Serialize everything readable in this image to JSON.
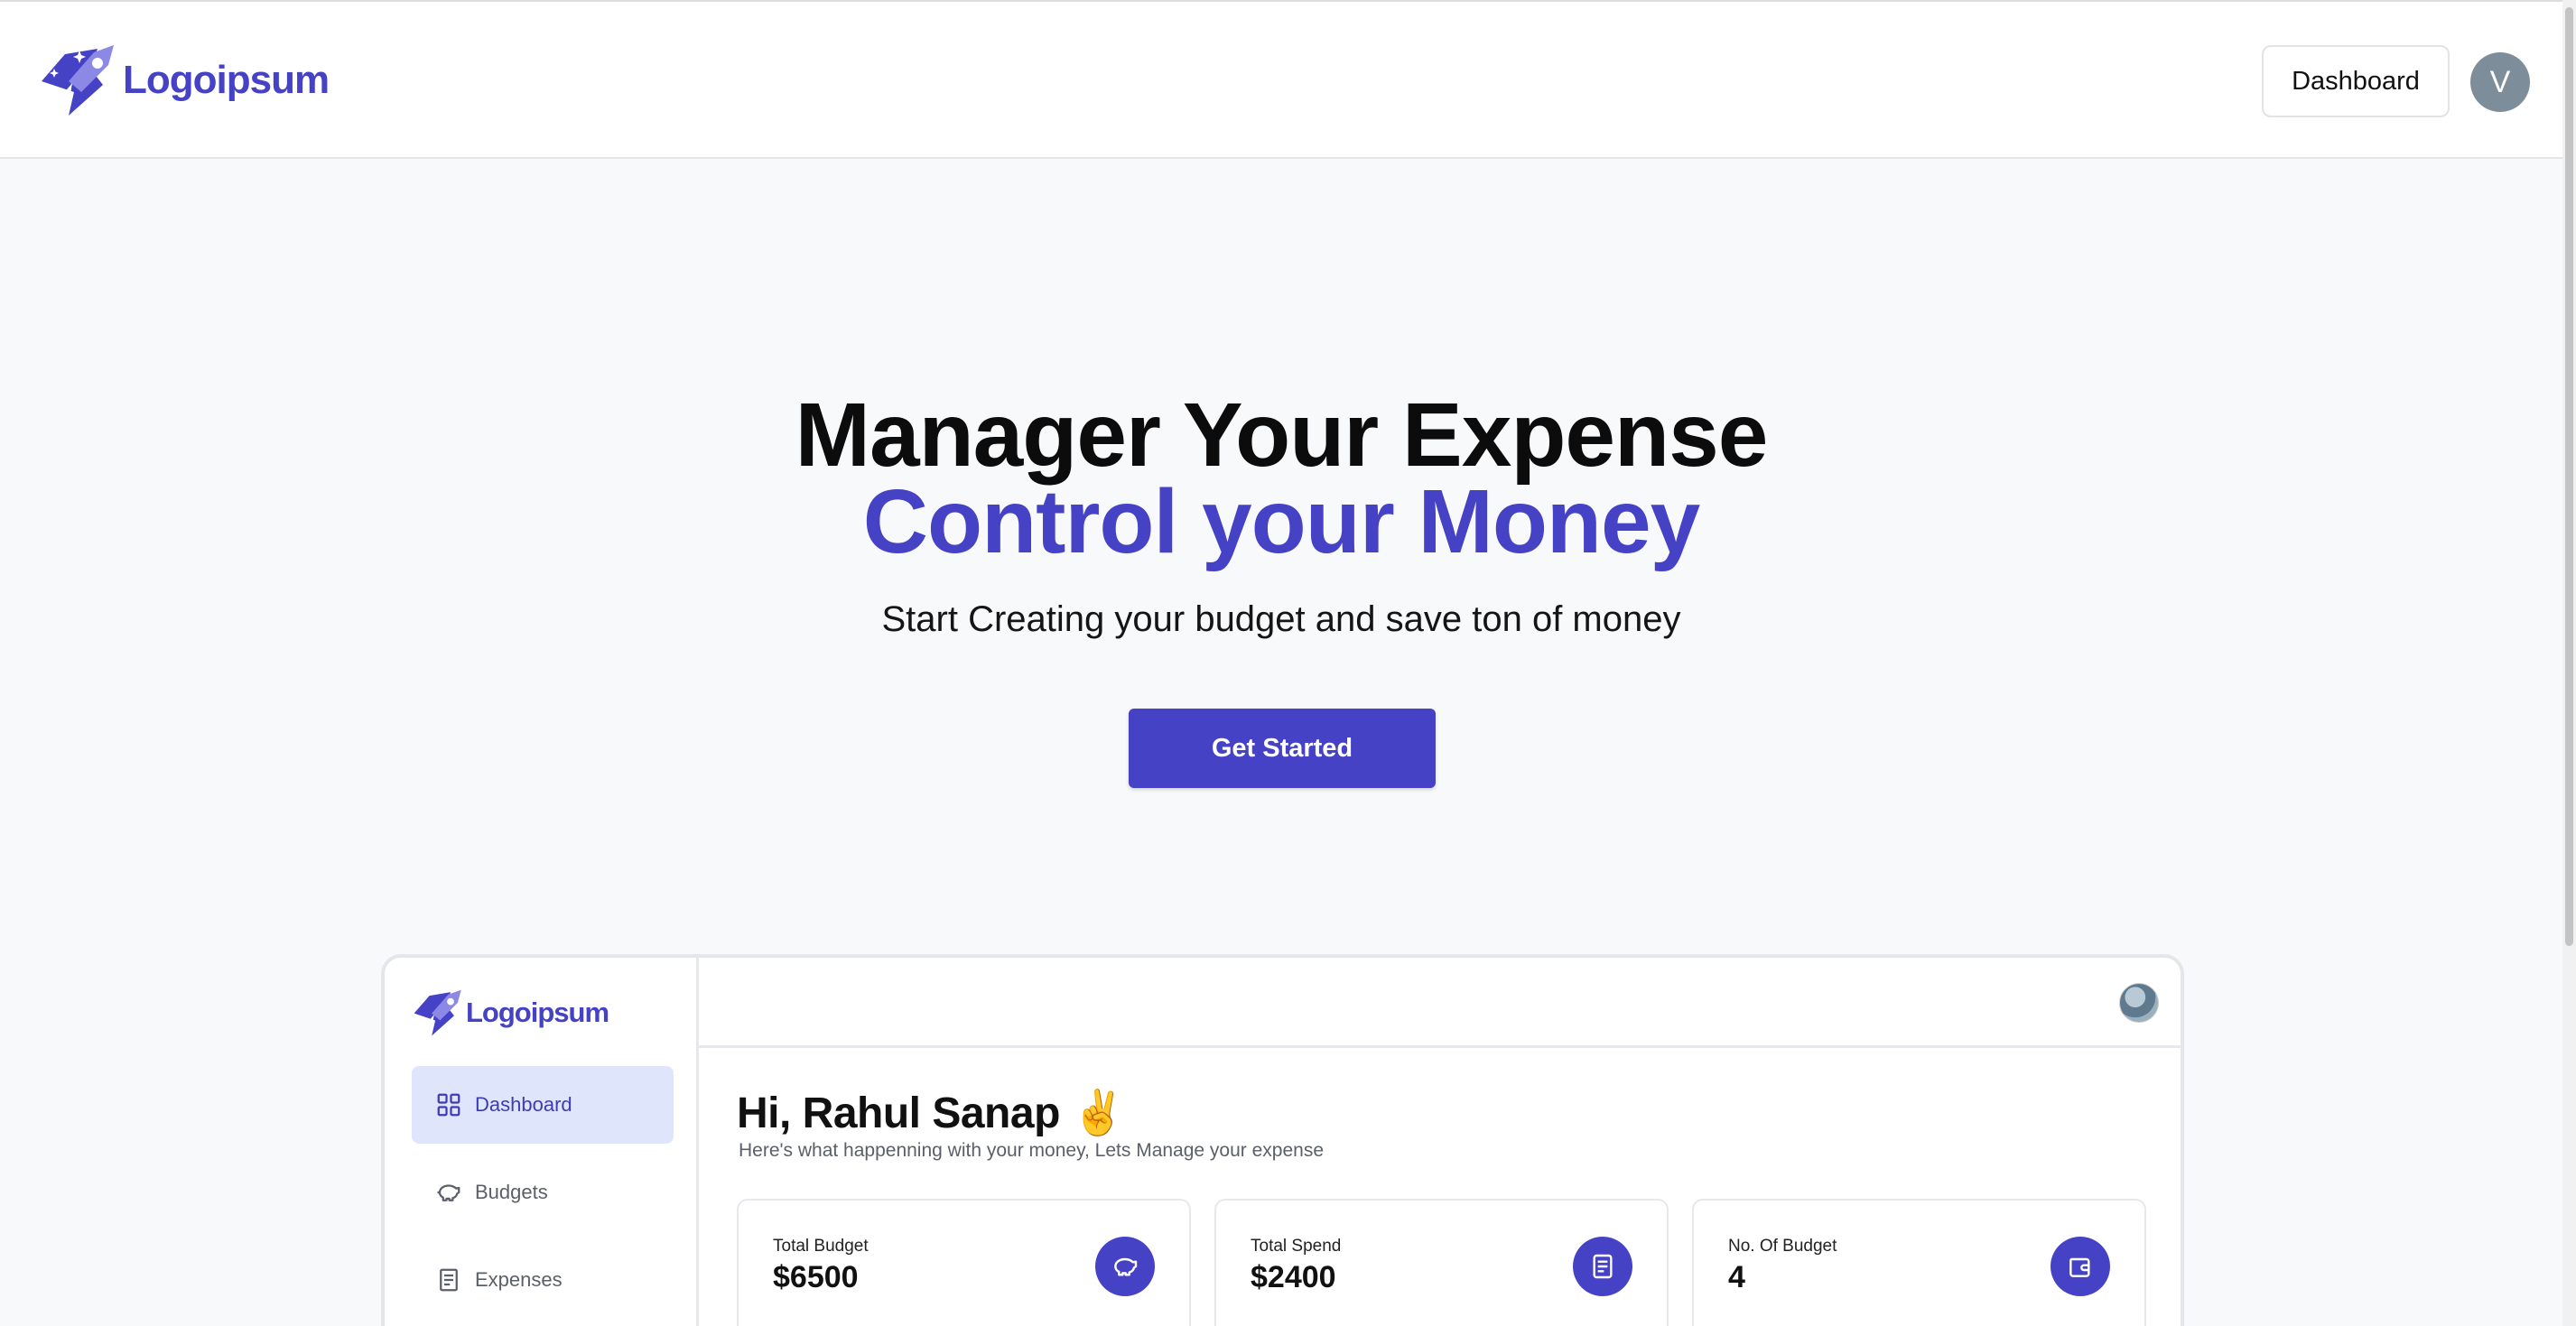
{
  "header": {
    "brand_name": "Logoipsum",
    "dashboard_label": "Dashboard",
    "avatar_initial": "V"
  },
  "hero": {
    "title_line1": "Manager Your Expense",
    "title_line2": "Control your Money",
    "subtitle": "Start Creating your budget and save ton of money",
    "cta_label": "Get Started"
  },
  "preview": {
    "brand_name": "Logoipsum",
    "sidebar": {
      "items": [
        {
          "label": "Dashboard",
          "icon": "grid-icon",
          "active": true
        },
        {
          "label": "Budgets",
          "icon": "piggy-bank-icon",
          "active": false
        },
        {
          "label": "Expenses",
          "icon": "receipt-icon",
          "active": false
        }
      ]
    },
    "greeting": "Hi, Rahul Sanap ✌️",
    "greeting_sub": "Here's what happenning with your money, Lets Manage your expense",
    "cards": [
      {
        "label": "Total Budget",
        "value": "$6500",
        "icon": "piggy-bank-icon"
      },
      {
        "label": "Total Spend",
        "value": "$2400",
        "icon": "receipt-icon"
      },
      {
        "label": "No. Of Budget",
        "value": "4",
        "icon": "wallet-icon"
      }
    ]
  },
  "colors": {
    "accent": "#4542c6",
    "page_bg": "#f8f9fb",
    "active_item_bg": "#dfe6fb"
  }
}
